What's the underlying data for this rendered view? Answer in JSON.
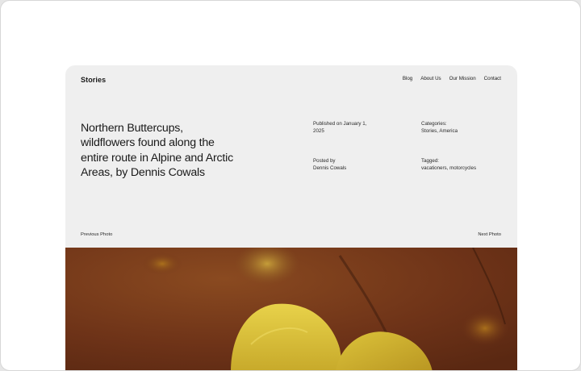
{
  "site": {
    "brand": "Stories"
  },
  "nav": {
    "items": [
      {
        "label": "Blog"
      },
      {
        "label": "About Us"
      },
      {
        "label": "Our Mission"
      },
      {
        "label": "Contact"
      }
    ]
  },
  "post": {
    "title": "Northern Buttercups, wildflowers found along the entire route in Alpine and Arctic Areas, by Dennis Cowals",
    "published_label": "Published on January 1,",
    "published_year": "2025",
    "categories_label": "Categories:",
    "categories_value": "Stories, America",
    "posted_label": "Posted by",
    "posted_value": "Dennis Cowals",
    "tagged_label": "Tagged:",
    "tagged_value": "vacationers, motorcycles"
  },
  "pager": {
    "previous": "Previous Photo",
    "next": "Next Photo"
  },
  "colors": {
    "card_bg": "#efefef",
    "photo_bg": "#7a3a1e",
    "petal": "#d8bf2a"
  }
}
